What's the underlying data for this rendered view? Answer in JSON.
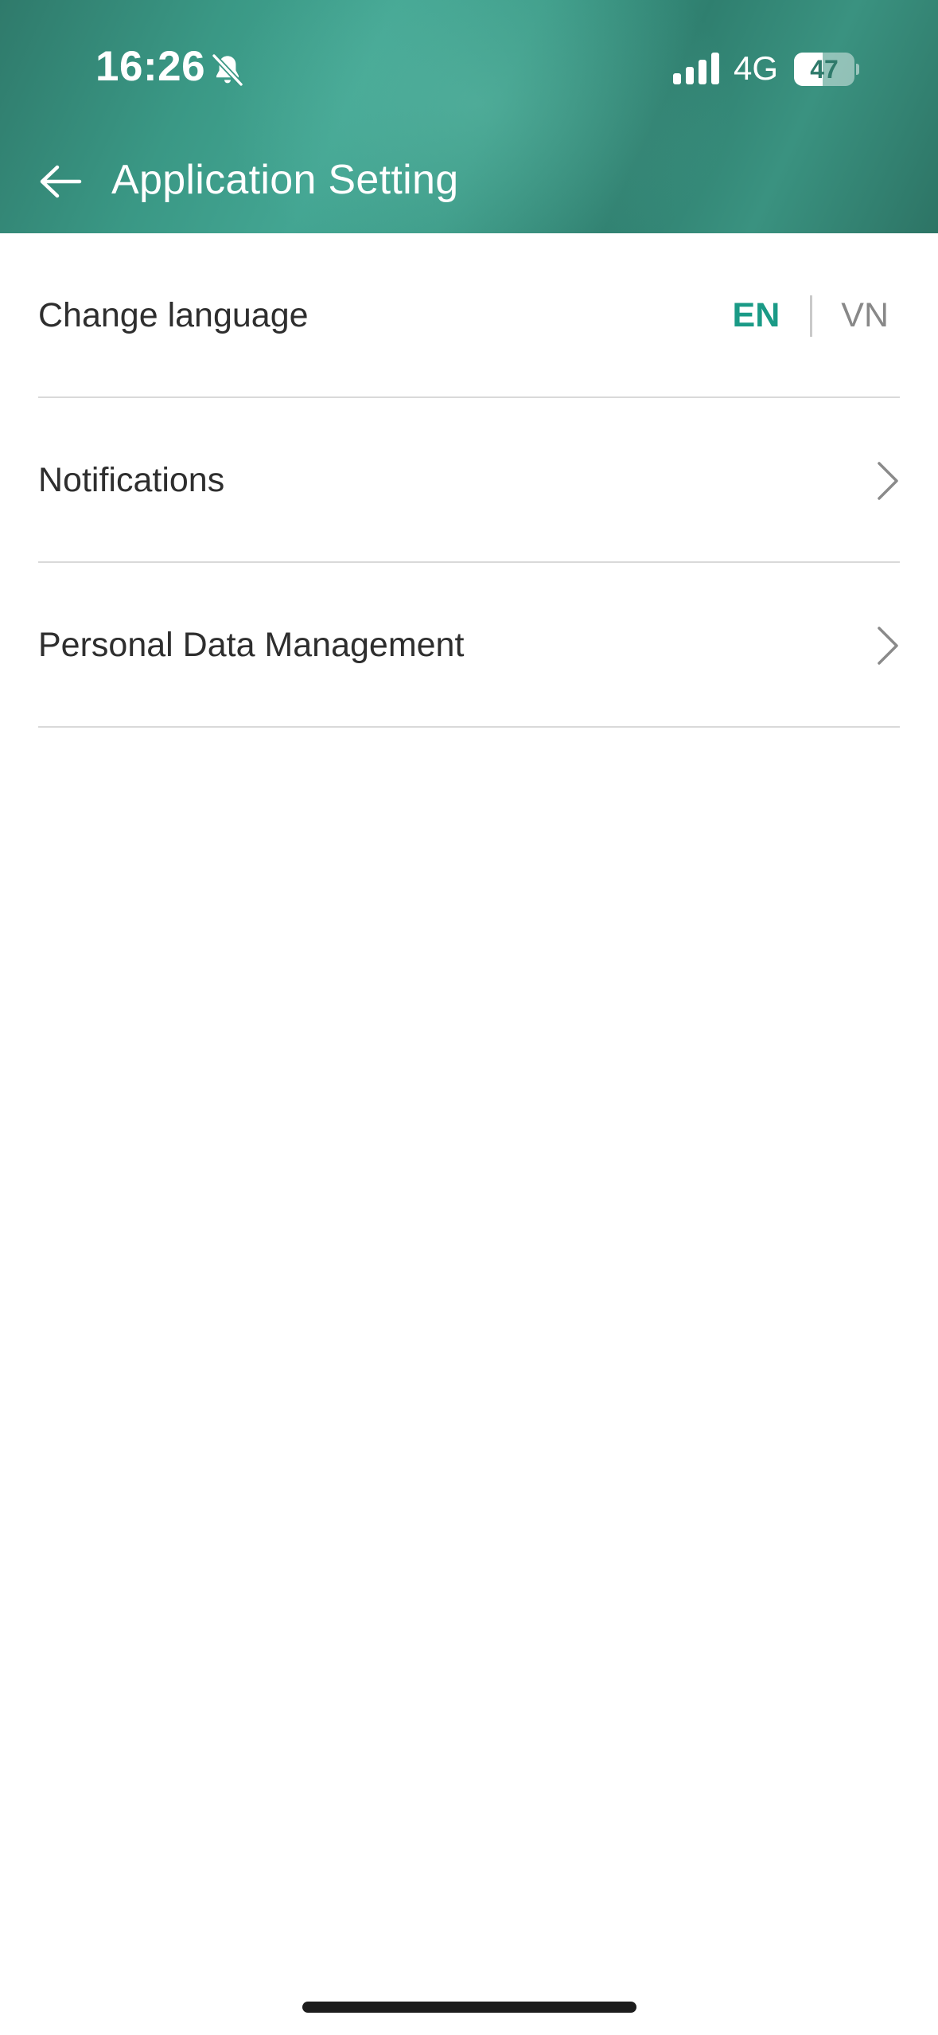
{
  "status_bar": {
    "time": "16:26",
    "network": "4G",
    "battery_level": "47",
    "battery_fraction": 0.47,
    "icons": [
      "bell-slash-icon",
      "cellular-signal-icon",
      "battery-icon"
    ]
  },
  "header": {
    "title": "Application Setting",
    "back_icon": "arrow-left-icon"
  },
  "settings": {
    "language": {
      "label": "Change language",
      "options": [
        "EN",
        "VN"
      ],
      "selected": "EN"
    },
    "notifications": {
      "label": "Notifications",
      "icon": "chevron-right-icon"
    },
    "personal_data": {
      "label": "Personal Data Management",
      "icon": "chevron-right-icon"
    }
  },
  "colors": {
    "header_gradient": [
      "#2f7a6b",
      "#43a592"
    ],
    "accent": "#1a9a86",
    "text_primary": "#2e2e2e",
    "text_muted": "#888888",
    "divider": "#d9d9d9"
  }
}
